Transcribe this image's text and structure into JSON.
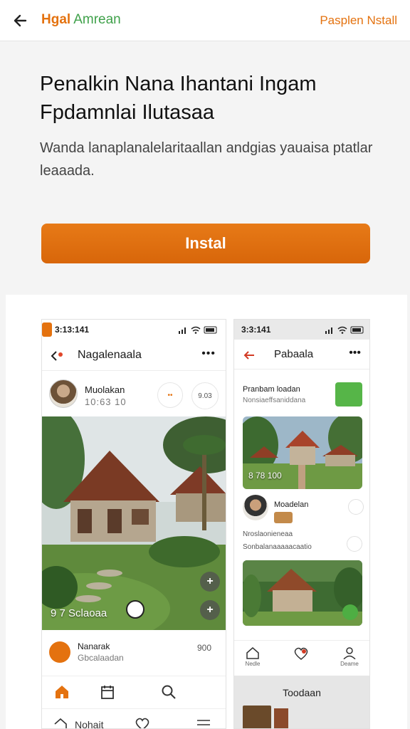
{
  "topbar": {
    "brand_primary": "Hgal",
    "brand_secondary": "Amrean",
    "action": "Pasplen Nstall"
  },
  "hero": {
    "title": "Penalkin Nana Ihantani Ingam Fpdamnlai Ilutasaa",
    "description": "Wanda lanaplanalelaritaallan andgias yauaisa ptatlar leaaada.",
    "install_button": "Instal"
  },
  "phone1": {
    "time": "3:13:141",
    "header_title": "Nagalenaala",
    "more": "•••",
    "post": {
      "name": "Muolakan",
      "meta": "10:63 10",
      "chip1": "••",
      "chip2": "9.03"
    },
    "photo_caption": "9 7 Sclaoaa",
    "author": {
      "name": "Nanarak",
      "sub": "Gbcalaadan",
      "count": "900"
    },
    "bottom_label": "Nohait"
  },
  "phone2": {
    "time": "3:3:141",
    "header_title": "Pabaala",
    "more": "•••",
    "item_title": "Pranbam loadan",
    "item_sub": "Nonsiaeffsaniddana",
    "image1_caption": "8 78 100",
    "author_name": "Moadelan",
    "line1": "Nroslaonieneaa",
    "line2": "Sonbalanaaaaacaatio",
    "tabs": [
      "Nedle",
      "",
      "Deame"
    ],
    "bottom_label": "Toodaan"
  },
  "colors": {
    "accent": "#e4720f",
    "green": "#3fa14a"
  }
}
